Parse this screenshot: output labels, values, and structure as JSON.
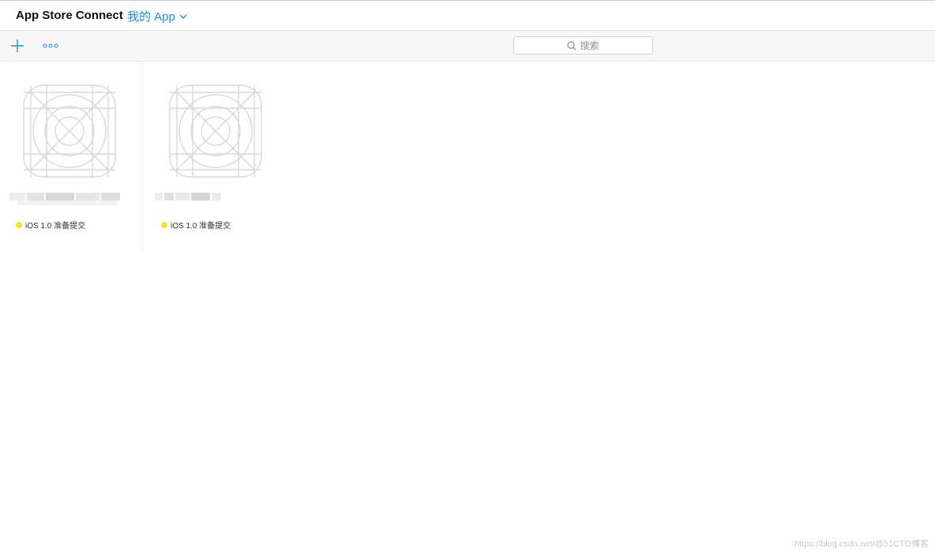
{
  "header": {
    "brand": "App Store Connect",
    "section": "我的 App"
  },
  "toolbar": {
    "add_icon": "plus-icon",
    "more_icon": "ellipsis-icon",
    "search_placeholder": "搜索"
  },
  "apps": [
    {
      "icon": "app-icon-placeholder",
      "status": "iOS 1.0 准备提交",
      "status_color": "#f2e52a"
    },
    {
      "icon": "app-icon-placeholder",
      "status": "iOS 1.0 准备提交",
      "status_color": "#f2e52a"
    }
  ],
  "watermark": "https://blog.csdn.net/@51CTO博客",
  "colors": {
    "accent": "#1a8cf0",
    "toolbar_bg": "#f7f7f7",
    "icon_line": "#d8d8d8"
  }
}
